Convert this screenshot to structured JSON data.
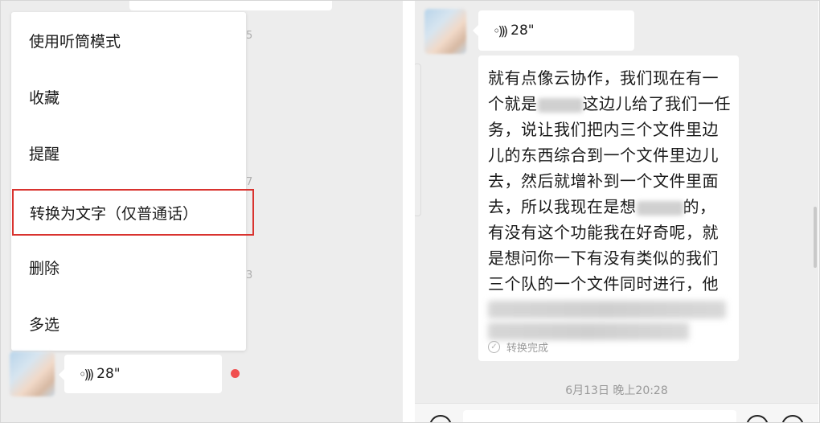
{
  "context_menu": {
    "items": [
      {
        "label": "使用听筒模式"
      },
      {
        "label": "收藏"
      },
      {
        "label": "提醒"
      },
      {
        "label": "转换为文字（仅普通话）"
      },
      {
        "label": "删除"
      },
      {
        "label": "多选"
      }
    ],
    "highlight_color": "#d9332f"
  },
  "left_chat": {
    "voice_message": {
      "duration": "28\"",
      "icon": "voice-wave-icon"
    },
    "unread_dot_color": "#f04f4f",
    "edge_digits": [
      "5",
      "7",
      "3"
    ]
  },
  "right_chat": {
    "voice_message": {
      "duration": "28\"",
      "icon": "voice-wave-icon"
    },
    "transcription": {
      "lines": [
        "就有点像云协作，我们现在有一",
        "这边儿给了我们一任",
        "务，说让我们把内三个文件里边",
        "儿的东西综合到一个文件里边儿",
        "去，然后就增补到一个文件里面",
        "去，所以我现在是想",
        "有没有这个功能我在好奇呢，就",
        "是想问你一下有没有类似的我们",
        "三个队的一个文件同时进行，他"
      ],
      "line2_prefix": "个就是",
      "line6_suffix": "的，",
      "status": "转换完成",
      "status_icon": "check-circle-icon"
    },
    "timestamp": "6月13日 晚上20:28"
  },
  "colors": {
    "chat_bg": "#ededed",
    "bubble": "#ffffff",
    "accent_red": "#d9332f"
  }
}
